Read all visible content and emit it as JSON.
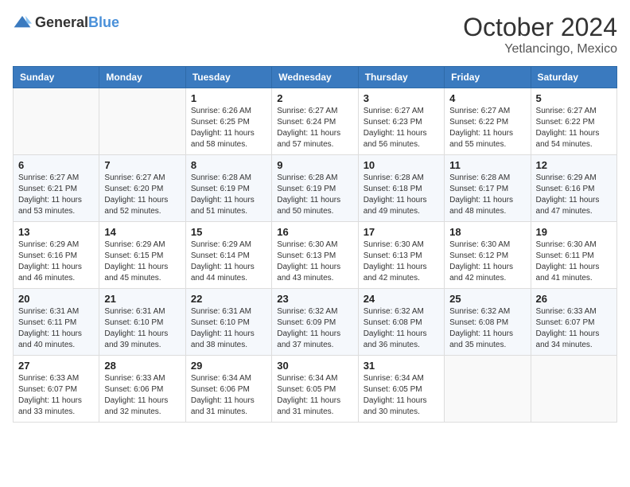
{
  "header": {
    "logo": {
      "general": "General",
      "blue": "Blue"
    },
    "month": "October 2024",
    "location": "Yetlancingo, Mexico"
  },
  "weekdays": [
    "Sunday",
    "Monday",
    "Tuesday",
    "Wednesday",
    "Thursday",
    "Friday",
    "Saturday"
  ],
  "weeks": [
    [
      null,
      null,
      {
        "day": 1,
        "sunrise": "6:26 AM",
        "sunset": "6:25 PM",
        "daylight": "11 hours and 58 minutes."
      },
      {
        "day": 2,
        "sunrise": "6:27 AM",
        "sunset": "6:24 PM",
        "daylight": "11 hours and 57 minutes."
      },
      {
        "day": 3,
        "sunrise": "6:27 AM",
        "sunset": "6:23 PM",
        "daylight": "11 hours and 56 minutes."
      },
      {
        "day": 4,
        "sunrise": "6:27 AM",
        "sunset": "6:22 PM",
        "daylight": "11 hours and 55 minutes."
      },
      {
        "day": 5,
        "sunrise": "6:27 AM",
        "sunset": "6:22 PM",
        "daylight": "11 hours and 54 minutes."
      }
    ],
    [
      {
        "day": 6,
        "sunrise": "6:27 AM",
        "sunset": "6:21 PM",
        "daylight": "11 hours and 53 minutes."
      },
      {
        "day": 7,
        "sunrise": "6:27 AM",
        "sunset": "6:20 PM",
        "daylight": "11 hours and 52 minutes."
      },
      {
        "day": 8,
        "sunrise": "6:28 AM",
        "sunset": "6:19 PM",
        "daylight": "11 hours and 51 minutes."
      },
      {
        "day": 9,
        "sunrise": "6:28 AM",
        "sunset": "6:19 PM",
        "daylight": "11 hours and 50 minutes."
      },
      {
        "day": 10,
        "sunrise": "6:28 AM",
        "sunset": "6:18 PM",
        "daylight": "11 hours and 49 minutes."
      },
      {
        "day": 11,
        "sunrise": "6:28 AM",
        "sunset": "6:17 PM",
        "daylight": "11 hours and 48 minutes."
      },
      {
        "day": 12,
        "sunrise": "6:29 AM",
        "sunset": "6:16 PM",
        "daylight": "11 hours and 47 minutes."
      }
    ],
    [
      {
        "day": 13,
        "sunrise": "6:29 AM",
        "sunset": "6:16 PM",
        "daylight": "11 hours and 46 minutes."
      },
      {
        "day": 14,
        "sunrise": "6:29 AM",
        "sunset": "6:15 PM",
        "daylight": "11 hours and 45 minutes."
      },
      {
        "day": 15,
        "sunrise": "6:29 AM",
        "sunset": "6:14 PM",
        "daylight": "11 hours and 44 minutes."
      },
      {
        "day": 16,
        "sunrise": "6:30 AM",
        "sunset": "6:13 PM",
        "daylight": "11 hours and 43 minutes."
      },
      {
        "day": 17,
        "sunrise": "6:30 AM",
        "sunset": "6:13 PM",
        "daylight": "11 hours and 42 minutes."
      },
      {
        "day": 18,
        "sunrise": "6:30 AM",
        "sunset": "6:12 PM",
        "daylight": "11 hours and 42 minutes."
      },
      {
        "day": 19,
        "sunrise": "6:30 AM",
        "sunset": "6:11 PM",
        "daylight": "11 hours and 41 minutes."
      }
    ],
    [
      {
        "day": 20,
        "sunrise": "6:31 AM",
        "sunset": "6:11 PM",
        "daylight": "11 hours and 40 minutes."
      },
      {
        "day": 21,
        "sunrise": "6:31 AM",
        "sunset": "6:10 PM",
        "daylight": "11 hours and 39 minutes."
      },
      {
        "day": 22,
        "sunrise": "6:31 AM",
        "sunset": "6:10 PM",
        "daylight": "11 hours and 38 minutes."
      },
      {
        "day": 23,
        "sunrise": "6:32 AM",
        "sunset": "6:09 PM",
        "daylight": "11 hours and 37 minutes."
      },
      {
        "day": 24,
        "sunrise": "6:32 AM",
        "sunset": "6:08 PM",
        "daylight": "11 hours and 36 minutes."
      },
      {
        "day": 25,
        "sunrise": "6:32 AM",
        "sunset": "6:08 PM",
        "daylight": "11 hours and 35 minutes."
      },
      {
        "day": 26,
        "sunrise": "6:33 AM",
        "sunset": "6:07 PM",
        "daylight": "11 hours and 34 minutes."
      }
    ],
    [
      {
        "day": 27,
        "sunrise": "6:33 AM",
        "sunset": "6:07 PM",
        "daylight": "11 hours and 33 minutes."
      },
      {
        "day": 28,
        "sunrise": "6:33 AM",
        "sunset": "6:06 PM",
        "daylight": "11 hours and 32 minutes."
      },
      {
        "day": 29,
        "sunrise": "6:34 AM",
        "sunset": "6:06 PM",
        "daylight": "11 hours and 31 minutes."
      },
      {
        "day": 30,
        "sunrise": "6:34 AM",
        "sunset": "6:05 PM",
        "daylight": "11 hours and 31 minutes."
      },
      {
        "day": 31,
        "sunrise": "6:34 AM",
        "sunset": "6:05 PM",
        "daylight": "11 hours and 30 minutes."
      },
      null,
      null
    ]
  ],
  "labels": {
    "sunrise": "Sunrise:",
    "sunset": "Sunset:",
    "daylight": "Daylight:"
  }
}
